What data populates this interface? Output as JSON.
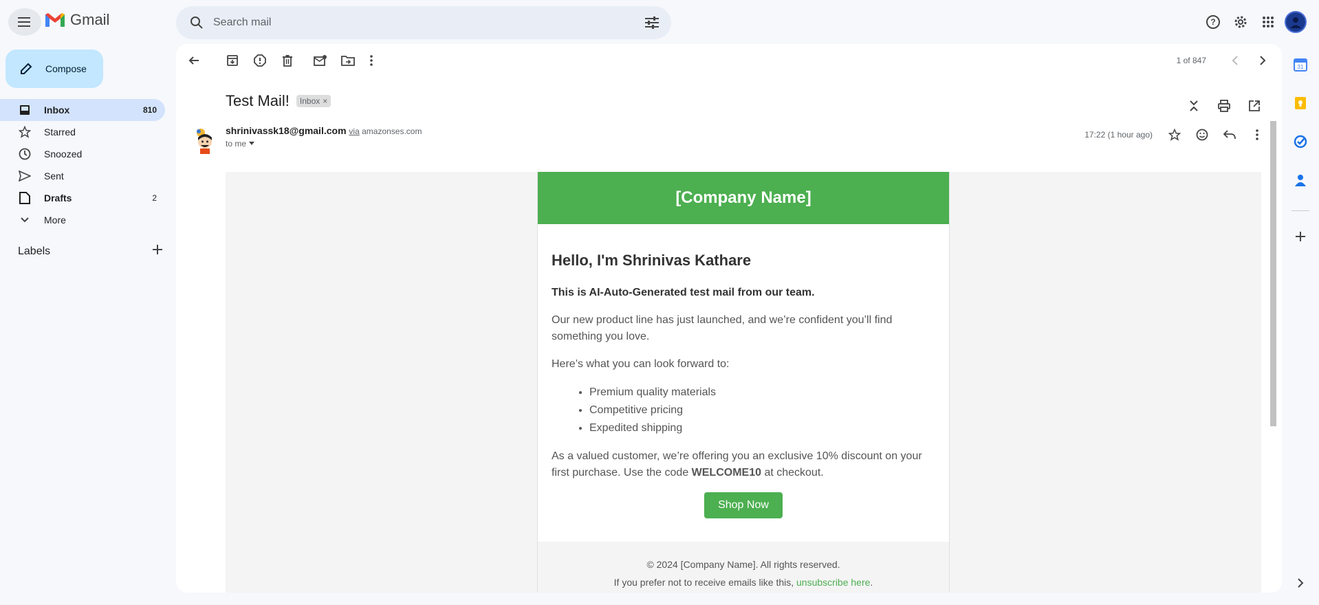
{
  "app": {
    "name": "Gmail"
  },
  "search": {
    "placeholder": "Search mail"
  },
  "sidebar": {
    "compose_label": "Compose",
    "items": [
      {
        "label": "Inbox",
        "count": "810"
      },
      {
        "label": "Starred",
        "count": ""
      },
      {
        "label": "Snoozed",
        "count": ""
      },
      {
        "label": "Sent",
        "count": ""
      },
      {
        "label": "Drafts",
        "count": "2"
      },
      {
        "label": "More",
        "count": ""
      }
    ],
    "labels_title": "Labels"
  },
  "toolbar": {
    "pager": "1 of 847"
  },
  "message": {
    "subject": "Test Mail!",
    "tag": "Inbox",
    "sender_email": "shrinivassk18@gmail.com",
    "via_word": "via",
    "via_domain": "amazonses.com",
    "to": "to me",
    "time": "17:22 (1 hour ago)"
  },
  "email": {
    "header": "[Company Name]",
    "greeting": "Hello, I'm Shrinivas Kathare",
    "intro": "This is AI-Auto-Generated test mail from our team.",
    "para1": "Our new product line has just launched, and we’re confident you’ll find something you love.",
    "para2": "Here’s what you can look forward to:",
    "list": [
      "Premium quality materials",
      "Competitive pricing",
      "Expedited shipping"
    ],
    "para3_before": "As a valued customer, we’re offering you an exclusive 10% discount on your first purchase. Use the code ",
    "code": "WELCOME10",
    "para3_after": " at checkout.",
    "button": "Shop Now",
    "footer_copy": "© 2024 [Company Name]. All rights reserved.",
    "footer_pref": "If you prefer not to receive emails like this, ",
    "unsubscribe": "unsubscribe here",
    "footer_end": "."
  },
  "colors": {
    "brand_green": "#4caf50",
    "compose_bg": "#c2e7ff",
    "active_nav": "#d3e3fd"
  }
}
